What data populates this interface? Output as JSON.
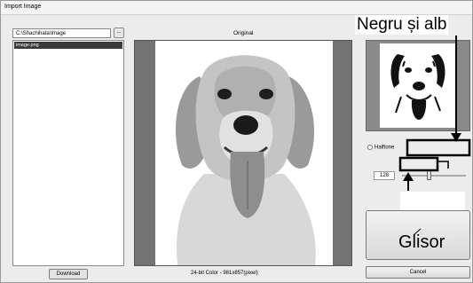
{
  "window": {
    "title": "Import Image"
  },
  "left": {
    "path": "C:\\Shachihata\\Image",
    "browse_label": "...",
    "files": [
      "image.png"
    ],
    "download_label": "Download"
  },
  "center": {
    "preview_title": "Original",
    "image_info": "24-bit Color - 981x857(pixel)"
  },
  "right": {
    "halftone_label": "Halftone",
    "threshold_value": "128",
    "threshold_fraction": 0.43,
    "big_button_label": "Glisor",
    "cancel_label": "Cancel"
  },
  "annotation": {
    "label": "Negru și alb"
  }
}
